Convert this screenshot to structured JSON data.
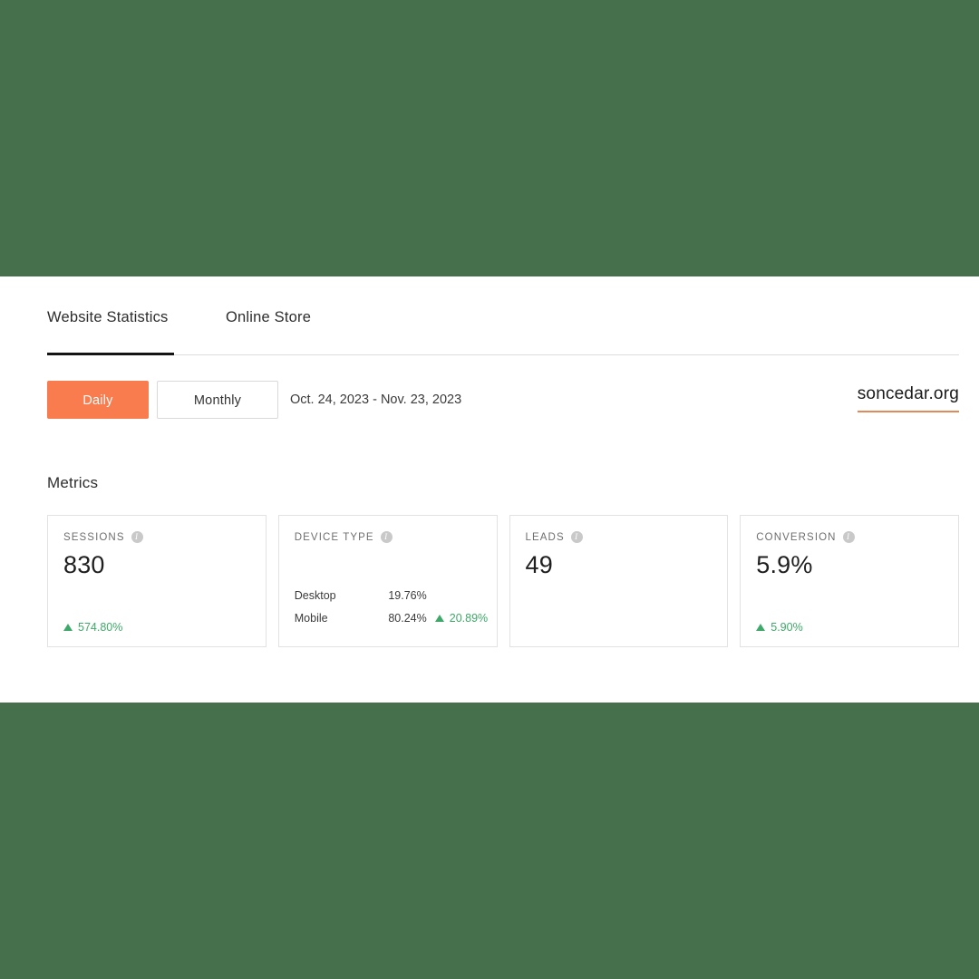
{
  "theme": {
    "band_color": "#46704b",
    "accent_orange": "#f97c4e",
    "positive_green": "#3ea968",
    "link_underline": "#e08a5a",
    "card_border": "#e2e2e2"
  },
  "tabs": [
    {
      "label": "Website Statistics",
      "active": true
    },
    {
      "label": "Online Store",
      "active": false
    }
  ],
  "controls": {
    "daily_label": "Daily",
    "monthly_label": "Monthly",
    "date_range": "Oct. 24, 2023 - Nov. 23, 2023",
    "site_link": "soncedar.org"
  },
  "metrics": {
    "heading": "Metrics",
    "info_icon_glyph": "i",
    "cards": [
      {
        "title": "SESSIONS",
        "value": "830",
        "delta": "574.80%",
        "delta_direction": "up"
      },
      {
        "title": "DEVICE TYPE",
        "rows": [
          {
            "label": "Desktop",
            "percent": "19.76%",
            "delta": "",
            "delta_direction": ""
          },
          {
            "label": "Mobile",
            "percent": "80.24%",
            "delta": "20.89%",
            "delta_direction": "up"
          }
        ]
      },
      {
        "title": "LEADS",
        "value": "49",
        "delta": "",
        "delta_direction": ""
      },
      {
        "title": "CONVERSION",
        "value": "5.9%",
        "delta": "5.90%",
        "delta_direction": "up"
      }
    ]
  }
}
